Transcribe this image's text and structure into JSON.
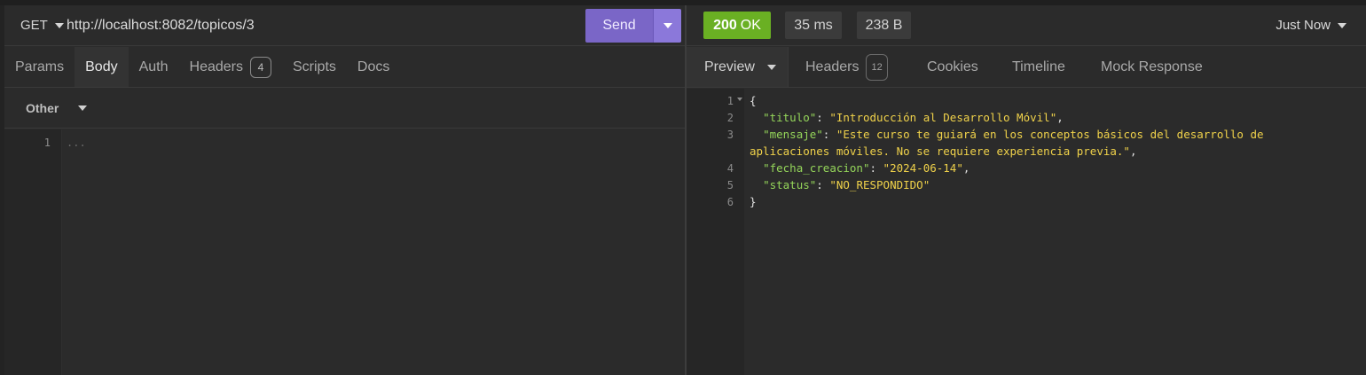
{
  "request": {
    "method": "GET",
    "url": "http://localhost:8082/topicos/3",
    "send_label": "Send",
    "tabs": [
      {
        "label": "Params"
      },
      {
        "label": "Body"
      },
      {
        "label": "Auth"
      },
      {
        "label": "Headers",
        "badge": "4"
      },
      {
        "label": "Scripts"
      },
      {
        "label": "Docs"
      }
    ],
    "active_tab": "Body",
    "body_type": "Other",
    "editor": {
      "line": "1",
      "placeholder": "..."
    }
  },
  "response": {
    "status_code": "200",
    "status_text": "OK",
    "time": "35 ms",
    "size": "238 B",
    "history": "Just Now",
    "tabs": {
      "preview": "Preview",
      "headers": "Headers",
      "headers_badge": "12",
      "cookies": "Cookies",
      "timeline": "Timeline",
      "mock": "Mock Response"
    },
    "body": {
      "line_numbers": [
        "1",
        "2",
        "3",
        "4",
        "5",
        "6"
      ],
      "open": "{",
      "close": "}",
      "fields": [
        {
          "key": "\"titulo\"",
          "value": "\"Introducción al Desarrollo Móvil\"",
          "trail": ","
        },
        {
          "key": "\"mensaje\"",
          "value": "\"Este curso te guiará en los conceptos básicos del desarrollo de",
          "value_cont": "aplicaciones móviles. No se requiere experiencia previa.\"",
          "trail": ","
        },
        {
          "key": "\"fecha_creacion\"",
          "value": "\"2024-06-14\"",
          "trail": ","
        },
        {
          "key": "\"status\"",
          "value": "\"NO_RESPONDIDO\"",
          "trail": ""
        }
      ]
    }
  },
  "colors": {
    "accent": "#7a66c7",
    "status_ok": "#6ab023",
    "json_key": "#95d65a",
    "json_string": "#f0d24a"
  }
}
